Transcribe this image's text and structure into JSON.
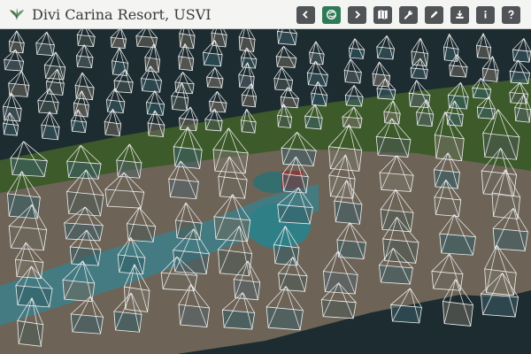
{
  "app": {
    "title": "Divi Carina Resort, USVI",
    "logo_icon": "leaf-logo-icon"
  },
  "toolbar": {
    "buttons": [
      {
        "icon": "arrow-left-icon",
        "active": false
      },
      {
        "icon": "globe-icon",
        "active": true
      },
      {
        "icon": "arrow-right-icon",
        "active": false
      },
      {
        "icon": "map-icon",
        "active": false
      },
      {
        "icon": "wrench-icon",
        "active": false
      },
      {
        "icon": "pencil-icon",
        "active": false
      },
      {
        "icon": "download-icon",
        "active": false
      },
      {
        "icon": "info-icon",
        "active": false
      },
      {
        "icon": "help-icon",
        "active": false
      }
    ]
  },
  "scene": {
    "type": "3d-point-cloud-with-camera-frustums",
    "colors": {
      "water": "#1d2c31",
      "vegetation": "#3d5a2a",
      "ground": "#6d6457",
      "pool": "#2f7f86",
      "frustum": "#f2f2f2",
      "accent": "#2f7a56"
    }
  }
}
